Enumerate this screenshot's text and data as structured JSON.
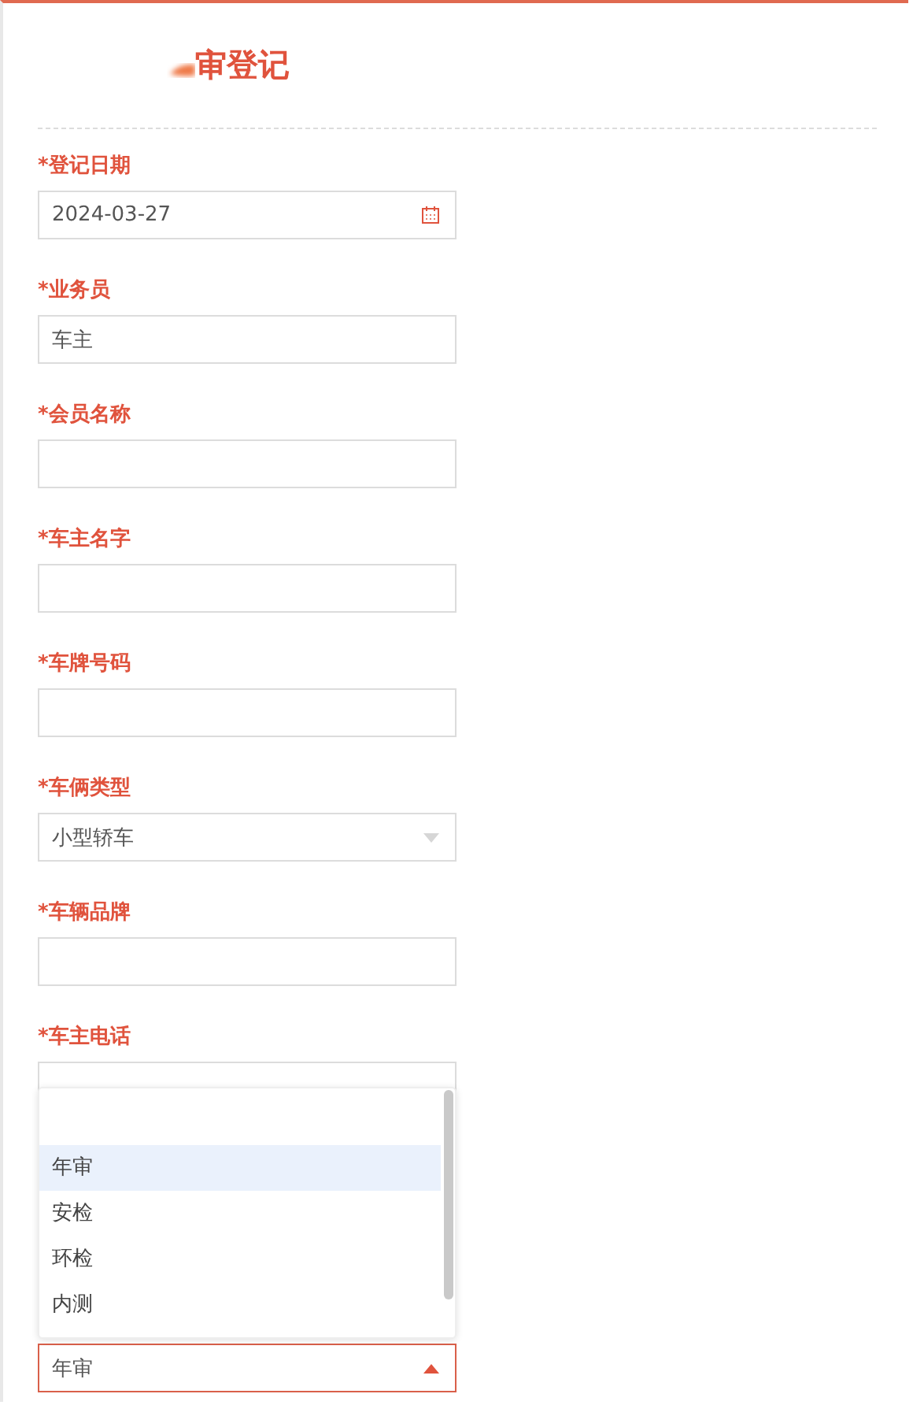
{
  "title": "审登记",
  "fields": [
    {
      "label": "*登记日期",
      "kind": "date",
      "value": "2024-03-27"
    },
    {
      "label": "*业务员",
      "kind": "text",
      "value": "车主"
    },
    {
      "label": "*会员名称",
      "kind": "text"
    },
    {
      "label": "*车主名字",
      "kind": "text"
    },
    {
      "label": "*车牌号码",
      "kind": "text"
    },
    {
      "label": "*车俩类型",
      "kind": "select",
      "value": "小型轿车",
      "open": false
    },
    {
      "label": "*车辆品牌",
      "kind": "text"
    },
    {
      "label": "*车主电话",
      "kind": "text"
    }
  ],
  "open_select": {
    "value": "年审",
    "open": true,
    "options": [
      {
        "label": "年审",
        "selected": true
      },
      {
        "label": "安检",
        "selected": false
      },
      {
        "label": "环检",
        "selected": false
      },
      {
        "label": "内测",
        "selected": false
      }
    ]
  }
}
